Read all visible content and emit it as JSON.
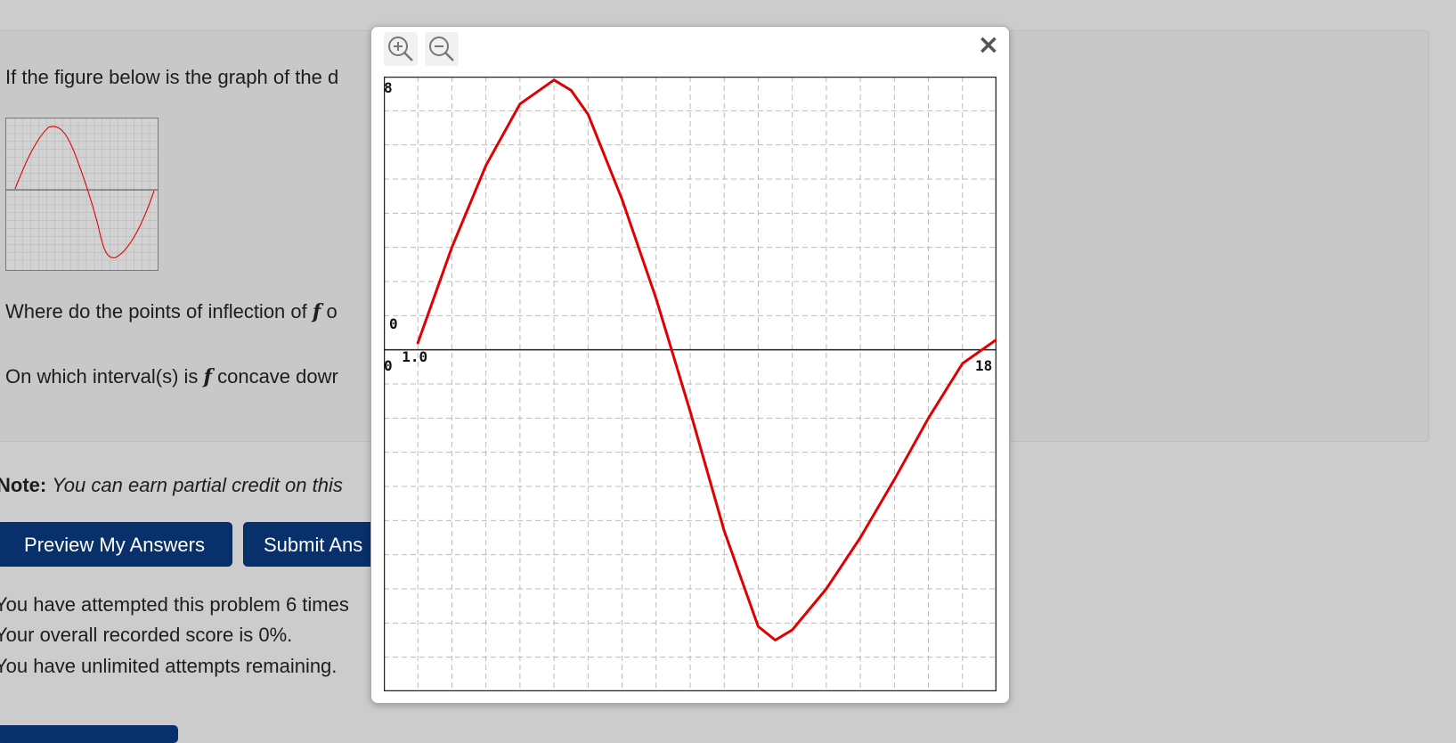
{
  "question": {
    "line1": "If the figure below is the graph of the d",
    "line2_prefix": "Where do the points of inflection of ",
    "line2_var": "f",
    "line2_suffix": " o",
    "line3_prefix": "On which interval(s) is ",
    "line3_var": "f",
    "line3_suffix": " concave dowr"
  },
  "note": {
    "label": "Note:",
    "text": "You can earn partial credit on this"
  },
  "buttons": {
    "preview": "Preview My Answers",
    "submit": "Submit Ans"
  },
  "status": {
    "attempts": "You have attempted this problem 6 times",
    "score": "Your overall recorded score is 0%.",
    "remaining": "You have unlimited attempts remaining."
  },
  "modal": {
    "zoom_in_icon": "zoom-in-icon",
    "zoom_out_icon": "zoom-out-icon",
    "close_label": "×",
    "close_icon": "close-icon"
  },
  "chart_data": {
    "type": "line",
    "title": "",
    "xlabel": "",
    "ylabel": "",
    "xlim": [
      0,
      18
    ],
    "ylim": [
      -10,
      8
    ],
    "grid": true,
    "tick_labels": {
      "y_top": "8",
      "y_mid": "0",
      "origin": "0",
      "x_start": "1.0",
      "x_end": "18"
    },
    "series": [
      {
        "color": "#e00000",
        "x": [
          1.0,
          2.0,
          3.0,
          4.0,
          5.0,
          5.5,
          6.0,
          7.0,
          8.0,
          9.0,
          10.0,
          11.0,
          11.5,
          12.0,
          13.0,
          14.0,
          15.0,
          16.0,
          17.0,
          18.0
        ],
        "y": [
          0.2,
          3.0,
          5.4,
          7.2,
          7.9,
          7.6,
          6.9,
          4.4,
          1.5,
          -1.8,
          -5.3,
          -8.1,
          -8.5,
          -8.2,
          -7.0,
          -5.5,
          -3.8,
          -2.0,
          -0.4,
          0.3
        ]
      }
    ]
  }
}
